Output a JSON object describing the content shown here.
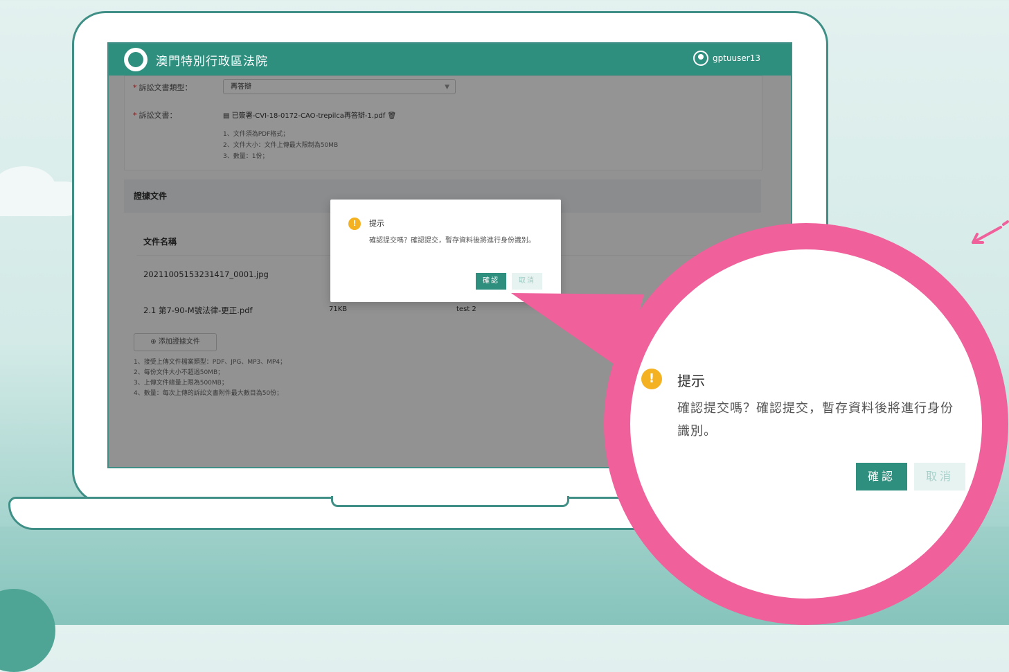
{
  "app": {
    "title": "澳門特別行政區法院",
    "username": "gptuuser13"
  },
  "form": {
    "doc_type_label": "訴訟文書類型：",
    "doc_type_value": "再答辯",
    "doc_label": "訴訟文書：",
    "doc_file": "已簽署-CVI-18-0172-CAO-trepilca再答辯-1.pdf",
    "doc_notes": [
      "1、文件須為PDF格式；",
      "2、文件大小：文件上傳最大限制為50MB",
      "3、數量：1份；"
    ]
  },
  "attachments": {
    "section_title": "證據文件",
    "column_name": "文件名稱",
    "rows": [
      {
        "name": "20211005153231417_0001.jpg",
        "size": "",
        "remark": ""
      },
      {
        "name": "2.1 第7-90-M號法律-更正.pdf",
        "size": "71KB",
        "remark": "test 2"
      }
    ],
    "add_button": "添加證據文件",
    "rules": [
      "1、接受上傳文件檔案類型：PDF、JPG、MP3、MP4；",
      "2、每份文件大小不超過50MB；",
      "3、上傳文件總量上限為500MB；",
      "4、數量：每次上傳的訴訟文書附件最大數目為50份；"
    ]
  },
  "dialog": {
    "title": "提示",
    "message": "確認提交嗎？確認提交，暫存資料後將進行身份識別。",
    "confirm": "確認",
    "cancel": "取消"
  },
  "zoom": {
    "title": "提示",
    "message": "確認提交嗎？確認提交，暫存資料後將進行身份識別。",
    "confirm": "確認",
    "cancel": "取消"
  },
  "colors": {
    "brand": "#2f8f7f",
    "callout": "#f0609b",
    "warning": "#f4b223"
  }
}
